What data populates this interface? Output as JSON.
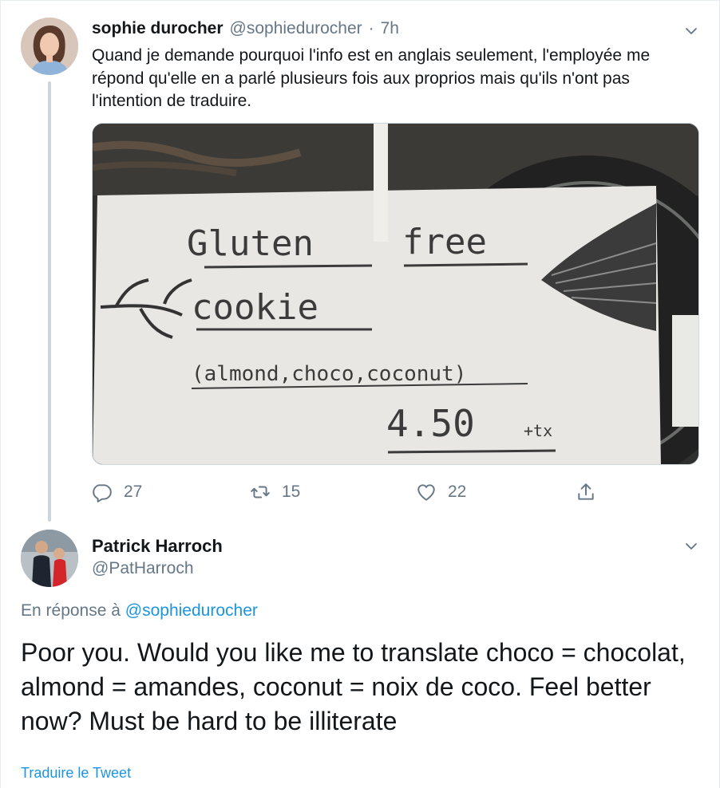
{
  "tweet": {
    "author_name": "sophie durocher",
    "handle": "@sophiedurocher",
    "separator": "·",
    "time": "7h",
    "text": "Quand je demande pourquoi l'info est en anglais seulement, l'employée me répond qu'elle en a parlé plusieurs fois aux proprios mais qu'ils n'ont pas l'intention de traduire.",
    "media": {
      "sign_line1_a": "Gluten",
      "sign_line1_b": "free",
      "sign_line2": "cookie",
      "sign_line3": "(almond,choco,coconut)",
      "sign_price": "4.50",
      "sign_tax": "+tx"
    },
    "actions": {
      "reply_count": "27",
      "retweet_count": "15",
      "like_count": "22"
    }
  },
  "reply": {
    "author_name": "Patrick Harroch",
    "handle": "@PatHarroch",
    "in_reply_prefix": "En réponse à",
    "in_reply_mention": "@sophiedurocher",
    "text": "Poor you. Would you like me to translate choco = chocolat, almond = amandes, coconut = noix de coco. Feel better now? Must be hard to be illiterate",
    "translate_label": "Traduire le Tweet"
  },
  "colors": {
    "accent": "#1b95e0",
    "muted": "#657786",
    "text": "#14171a",
    "border": "#ccd6dd"
  },
  "icons": [
    "chevron-down-icon",
    "reply-icon",
    "retweet-icon",
    "like-icon",
    "share-icon"
  ]
}
